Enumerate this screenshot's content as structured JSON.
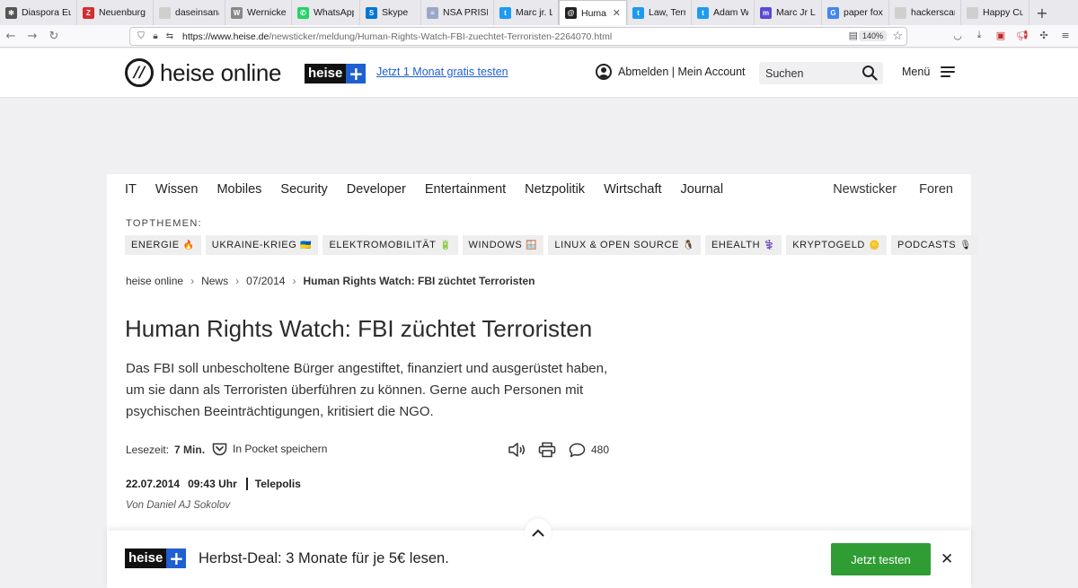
{
  "browser": {
    "tabs": [
      {
        "label": "Diaspora Eu",
        "fav": "diaspora-icon",
        "color": "#555555",
        "glyph": "✻"
      },
      {
        "label": "Neuenburg",
        "fav": "z-icon",
        "color": "#d32f2f",
        "glyph": "Z"
      },
      {
        "label": "daseinsanalyse",
        "fav": "blank-icon",
        "color": "#cfcfcf",
        "glyph": ""
      },
      {
        "label": "Wernicke-Z",
        "fav": "wikipedia-icon",
        "color": "#888888",
        "glyph": "W"
      },
      {
        "label": "WhatsApp",
        "fav": "whatsapp-icon",
        "color": "#25d366",
        "glyph": "✆"
      },
      {
        "label": "Skype",
        "fav": "skype-icon",
        "color": "#0078d4",
        "glyph": "S"
      },
      {
        "label": "NSA PRISM",
        "fav": "flag-icon",
        "color": "#9aa7c7",
        "glyph": "≡"
      },
      {
        "label": "Marc jr. Lan",
        "fav": "twitter-icon",
        "color": "#1d9bf0",
        "glyph": "t"
      },
      {
        "label": "Human Ri",
        "fav": "heise-icon",
        "color": "#222222",
        "glyph": "@"
      },
      {
        "label": "Law, Terror",
        "fav": "twitter-icon",
        "color": "#1d9bf0",
        "glyph": "t"
      },
      {
        "label": "Adam Wagn",
        "fav": "twitter-icon",
        "color": "#1d9bf0",
        "glyph": "t"
      },
      {
        "label": "Marc Jr LAN",
        "fav": "mastodon-icon",
        "color": "#5b4ad3",
        "glyph": "m"
      },
      {
        "label": "paper fox –",
        "fav": "google-icon",
        "color": "#4285f4",
        "glyph": "G"
      },
      {
        "label": "hackerscardgar",
        "fav": "blank-icon",
        "color": "#cfcfcf",
        "glyph": ""
      },
      {
        "label": "Happy Cube Sc",
        "fav": "blank-icon",
        "color": "#cfcfcf",
        "glyph": ""
      }
    ],
    "active_tab": 8,
    "url_host": "https://www.heise.de",
    "url_path": "/newsticker/meldung/Human-Rights-Watch-FBI-zuechtet-Terroristen-2264070.html",
    "zoom": "140%"
  },
  "header": {
    "logo_text": "heise online",
    "plus_badge": "heise",
    "plus_sign": "+",
    "promo_link": "Jetzt 1 Monat gratis testen",
    "account_label": "Abmelden | Mein Account",
    "search_placeholder": "Suchen",
    "menu_label": "Menü"
  },
  "nav": {
    "categories": [
      "IT",
      "Wissen",
      "Mobiles",
      "Security",
      "Developer",
      "Entertainment",
      "Netzpolitik",
      "Wirtschaft",
      "Journal"
    ],
    "right": [
      "Newsticker",
      "Foren"
    ]
  },
  "topics": {
    "label": "TOPTHEMEN:",
    "items": [
      {
        "label": "ENERGIE",
        "emoji": "🔥"
      },
      {
        "label": "UKRAINE-KRIEG",
        "emoji": "🇺🇦"
      },
      {
        "label": "ELEKTROMOBILITÄT",
        "emoji": "🔋"
      },
      {
        "label": "WINDOWS",
        "emoji": "🪟"
      },
      {
        "label": "LINUX & OPEN SOURCE",
        "emoji": "🐧"
      },
      {
        "label": "EHEALTH",
        "emoji": "⚕️"
      },
      {
        "label": "KRYPTOGELD",
        "emoji": "🪙"
      },
      {
        "label": "PODCASTS",
        "emoji": "🎙"
      }
    ]
  },
  "breadcrumb": {
    "items": [
      "heise online",
      "News",
      "07/2014"
    ],
    "current": "Human Rights Watch: FBI züchtet Terroristen"
  },
  "article": {
    "title": "Human Rights Watch: FBI züchtet Terroristen",
    "lead": "Das FBI soll unbescholtene Bürger angestiftet, finanziert und ausgerüstet haben, um sie dann als Terroristen überführen zu können. Gerne auch Personen mit psychischen Beeinträchtigungen, kritisiert die NGO.",
    "reading_label": "Lesezeit:",
    "reading_time": "7 Min.",
    "pocket_label": "In Pocket speichern",
    "comment_count": "480",
    "date": "22.07.2014",
    "time": "09:43 Uhr",
    "source": "Telepolis",
    "author": "Von Daniel AJ Sokolov"
  },
  "promo": {
    "badge": "heise",
    "plus_sign": "+",
    "deal_text": "Herbst-Deal: 3 Monate für je 5€ lesen.",
    "cta_label": "Jetzt testen",
    "cta_color": "#2f9d34",
    "accent": "#1f5fd1"
  }
}
